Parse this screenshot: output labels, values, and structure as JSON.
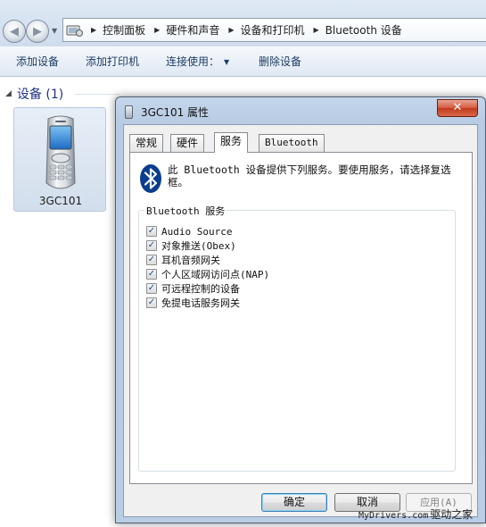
{
  "address_bar": {
    "crumbs": [
      "控制面板",
      "硬件和声音",
      "设备和打印机",
      "Bluetooth 设备"
    ]
  },
  "command_bar": {
    "add_device": "添加设备",
    "add_printer": "添加打印机",
    "connect_using": "连接使用：",
    "remove_device": "删除设备"
  },
  "devices_group": {
    "title": "设备 (1)",
    "device_name": "3GC101"
  },
  "dialog": {
    "title": "3GC101 属性",
    "close_glyph": "✕",
    "tabs": [
      {
        "label": "常规"
      },
      {
        "label": "硬件"
      },
      {
        "label": "服务"
      },
      {
        "label": "Bluetooth"
      }
    ],
    "active_tab": "服务",
    "description": "此 Bluetooth 设备提供下列服务。要使用服务，请选择复选框。",
    "services_group_label": "Bluetooth 服务",
    "services": [
      {
        "label": "Audio Source",
        "checked": true
      },
      {
        "label": "对象推送(Obex)",
        "checked": true
      },
      {
        "label": "耳机音频网关",
        "checked": true
      },
      {
        "label": "个人区域网访问点(NAP)",
        "checked": true
      },
      {
        "label": "可远程控制的设备",
        "checked": true
      },
      {
        "label": "免提电话服务网关",
        "checked": true
      }
    ],
    "buttons": {
      "ok": "确定",
      "cancel": "取消",
      "apply": "应用(A)"
    }
  },
  "watermark": {
    "site": "MyDrivers.com",
    "cn": "驱动之家"
  },
  "colors": {
    "command_text": "#1e3c64",
    "group_title": "#1e3287",
    "bluetooth_blue": "#0a3e8c",
    "close_red": "#c23a1c"
  }
}
